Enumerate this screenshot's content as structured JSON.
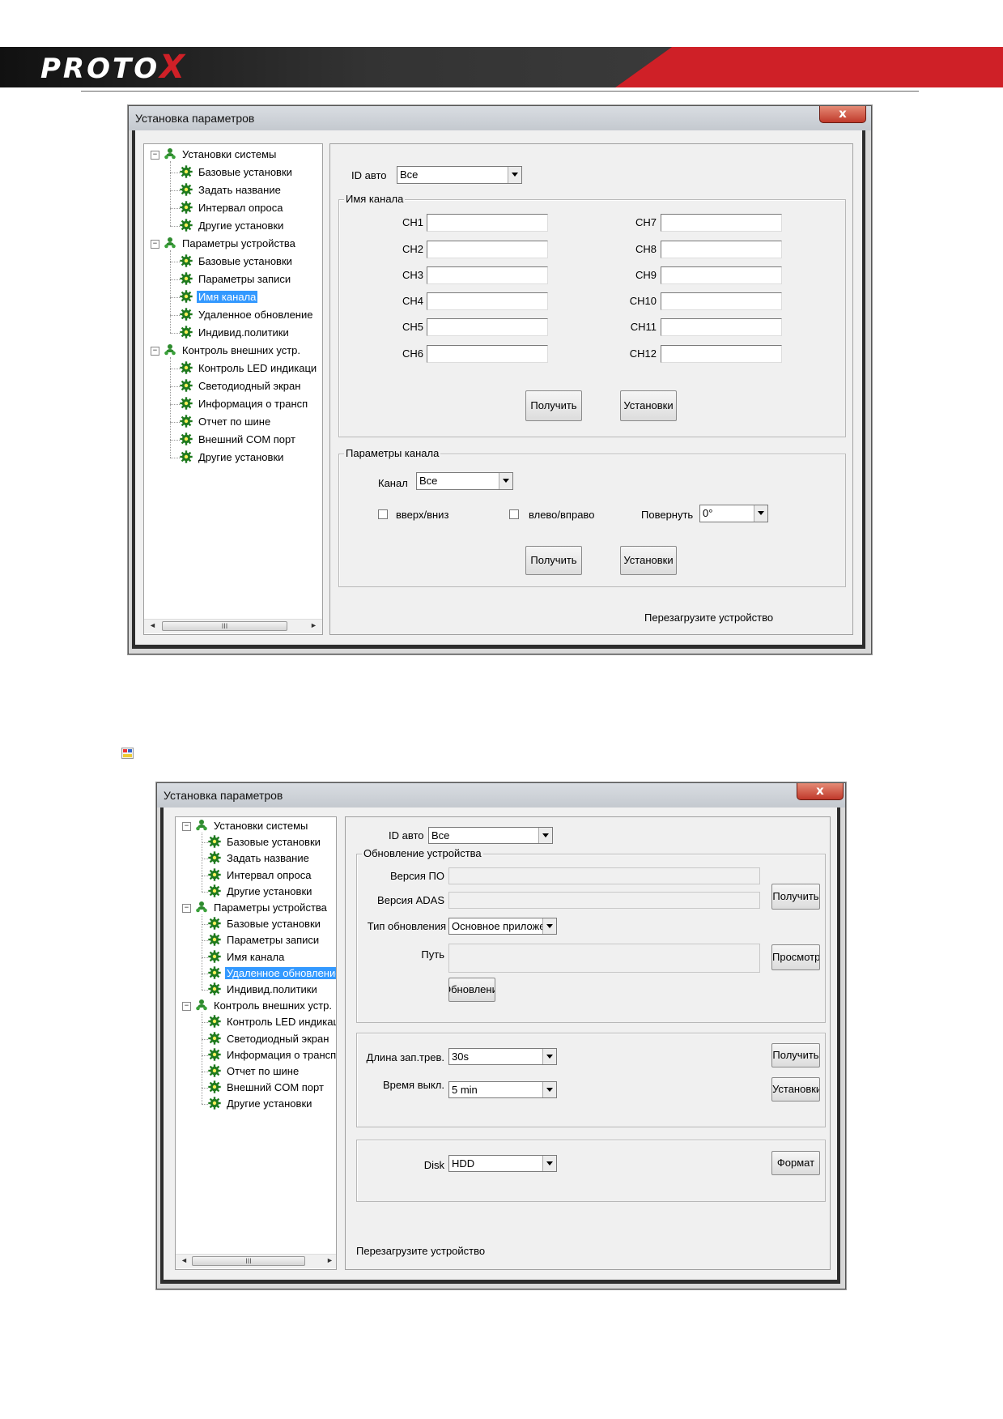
{
  "header": {
    "logo_text": "PROTO",
    "logo_x": "X",
    "accent_color": "#cf2027"
  },
  "broken_image_icon": "broken-image-icon",
  "win1": {
    "title": "Установка параметров",
    "close": "x",
    "tree": [
      {
        "label": "Установки системы",
        "level": 0,
        "icon": "group-icon"
      },
      {
        "label": "Базовые установки",
        "level": 1,
        "icon": "gear-icon"
      },
      {
        "label": "Задать название",
        "level": 1,
        "icon": "gear-icon"
      },
      {
        "label": "Интервал опроса",
        "level": 1,
        "icon": "gear-icon"
      },
      {
        "label": "Другие установки",
        "level": 1,
        "icon": "gear-icon"
      },
      {
        "label": "Параметры устройства",
        "level": 0,
        "icon": "group-icon"
      },
      {
        "label": "Базовые установки",
        "level": 1,
        "icon": "gear-icon"
      },
      {
        "label": "Параметры записи",
        "level": 1,
        "icon": "gear-icon"
      },
      {
        "label": "Имя канала",
        "level": 1,
        "icon": "gear-icon",
        "selected": true
      },
      {
        "label": "Удаленное обновление",
        "level": 1,
        "icon": "gear-icon"
      },
      {
        "label": "Индивид.политики",
        "level": 1,
        "icon": "gear-icon"
      },
      {
        "label": "Контроль внешних устр.",
        "level": 0,
        "icon": "group-icon"
      },
      {
        "label": "Контроль LED индикаци",
        "level": 1,
        "icon": "gear-icon"
      },
      {
        "label": "Светодиодный экран",
        "level": 1,
        "icon": "gear-icon"
      },
      {
        "label": "Информация о трансп",
        "level": 1,
        "icon": "gear-icon"
      },
      {
        "label": "Отчет по шине",
        "level": 1,
        "icon": "gear-icon"
      },
      {
        "label": "Внешний COM порт",
        "level": 1,
        "icon": "gear-icon"
      },
      {
        "label": "Другие установки",
        "level": 1,
        "icon": "gear-icon"
      }
    ],
    "scroll_thumb": "III",
    "id_label": "ID авто",
    "id_value": "Все",
    "channel_group": "Имя канала",
    "channels_left": [
      "CH1",
      "CH2",
      "CH3",
      "CH4",
      "CH5",
      "CH6"
    ],
    "channels_right": [
      "CH7",
      "CH8",
      "CH9",
      "CH10",
      "CH11",
      "CH12"
    ],
    "get_btn": "Получить",
    "set_btn": "Установки",
    "params_group": "Параметры канала",
    "channel_label": "Канал",
    "channel_value": "Все",
    "updown": "вверх/вниз",
    "leftright": "влево/вправо",
    "rotate_label": "Повернуть",
    "rotate_value": "0°",
    "get_btn2": "Получить",
    "set_btn2": "Установки",
    "status": "Перезагрузите устройство"
  },
  "win2": {
    "title": "Установка параметров",
    "close": "x",
    "tree": [
      {
        "label": "Установки системы",
        "level": 0,
        "icon": "group-icon"
      },
      {
        "label": "Базовые установки",
        "level": 1,
        "icon": "gear-icon"
      },
      {
        "label": "Задать название",
        "level": 1,
        "icon": "gear-icon"
      },
      {
        "label": "Интервал опроса",
        "level": 1,
        "icon": "gear-icon"
      },
      {
        "label": "Другие установки",
        "level": 1,
        "icon": "gear-icon"
      },
      {
        "label": "Параметры устройства",
        "level": 0,
        "icon": "group-icon"
      },
      {
        "label": "Базовые установки",
        "level": 1,
        "icon": "gear-icon"
      },
      {
        "label": "Параметры записи",
        "level": 1,
        "icon": "gear-icon"
      },
      {
        "label": "Имя канала",
        "level": 1,
        "icon": "gear-icon"
      },
      {
        "label": "Удаленное обновление",
        "level": 1,
        "icon": "gear-icon",
        "selected": true
      },
      {
        "label": "Индивид.политики",
        "level": 1,
        "icon": "gear-icon"
      },
      {
        "label": "Контроль внешних устр.",
        "level": 0,
        "icon": "group-icon"
      },
      {
        "label": "Контроль LED индикаци",
        "level": 1,
        "icon": "gear-icon"
      },
      {
        "label": "Светодиодный экран",
        "level": 1,
        "icon": "gear-icon"
      },
      {
        "label": "Информация о трансп",
        "level": 1,
        "icon": "gear-icon"
      },
      {
        "label": "Отчет по шине",
        "level": 1,
        "icon": "gear-icon"
      },
      {
        "label": "Внешний COM порт",
        "level": 1,
        "icon": "gear-icon"
      },
      {
        "label": "Другие установки",
        "level": 1,
        "icon": "gear-icon"
      }
    ],
    "scroll_thumb": "III",
    "id_label": "ID авто",
    "id_value": "Все",
    "update_group": "Обновление устройства",
    "fw_label": "Версия ПО",
    "adas_label": "Версия ADAS",
    "get_btn": "Получить",
    "update_type_label": "Тип обновления",
    "update_type_value": "Основное приложе",
    "path_label": "Путь",
    "browse_btn": "Просмотр",
    "update_btn": "Обновлени",
    "alarm_label": "Длина зап.трев.",
    "alarm_value": "30s",
    "off_label": "Время выкл.",
    "off_value": "5 min",
    "get_btn2": "Получить",
    "set_btn2": "Установки",
    "disk_label": "Disk",
    "disk_value": "HDD",
    "format_btn": "Формат",
    "status": "Перезагрузите устройство"
  }
}
